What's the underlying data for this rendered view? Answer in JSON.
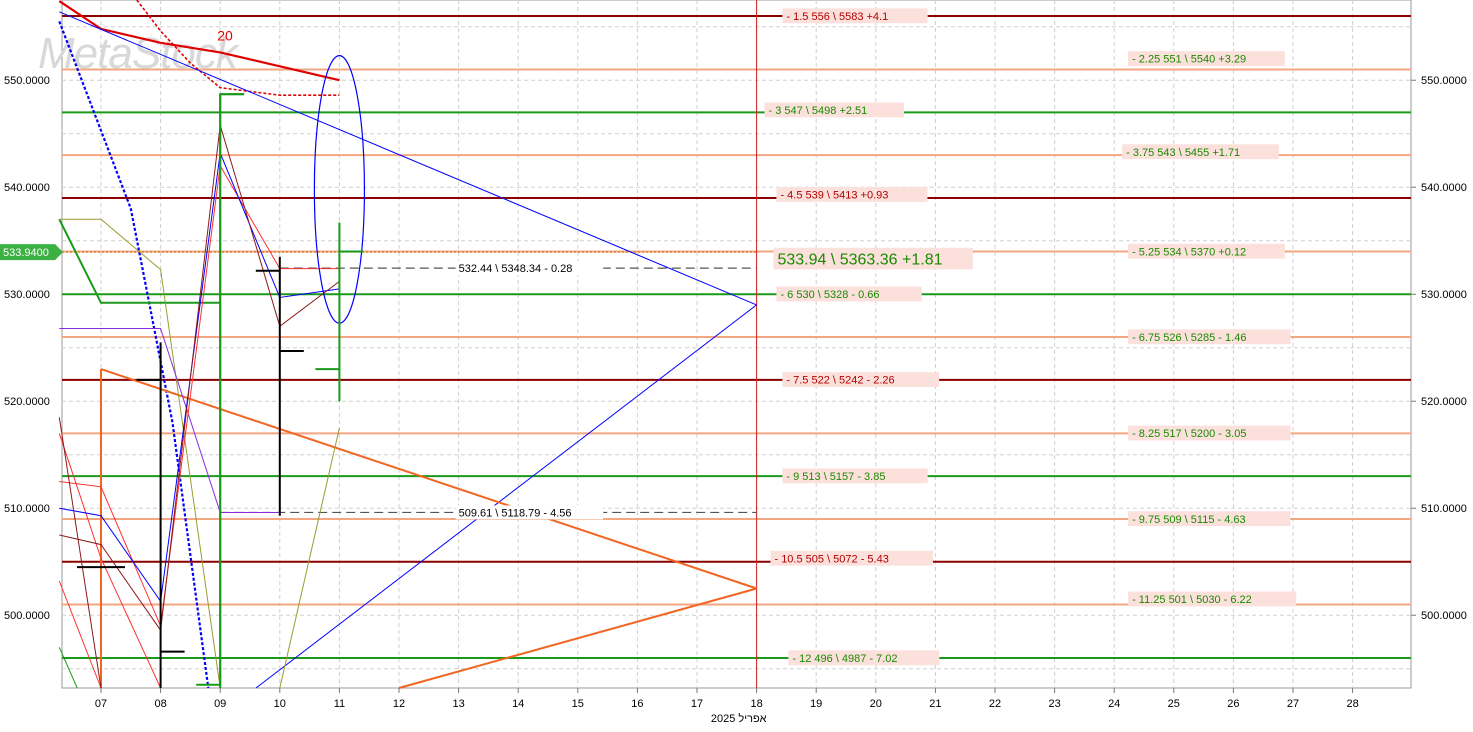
{
  "chart_data": {
    "type": "line",
    "watermark": "MetaStock",
    "month_label": "אפריל 2025",
    "x_ticks": [
      "07",
      "08",
      "09",
      "10",
      "11",
      "12",
      "13",
      "14",
      "15",
      "16",
      "17",
      "18",
      "19",
      "20",
      "21",
      "22",
      "23",
      "24",
      "25",
      "26",
      "27",
      "28"
    ],
    "ylim": [
      493.2,
      557.5
    ],
    "y_ticks": [
      500,
      510,
      520,
      530,
      540,
      550
    ],
    "y_tick_labels": [
      "500.0000",
      "510.0000",
      "520.0000",
      "530.0000",
      "540.0000",
      "550.0000"
    ],
    "y_tick_labels_left": [
      "500.0000",
      "510.0000",
      "520.0000",
      "530.0000",
      "540.0000",
      "550.0000"
    ],
    "current_price": 533.94,
    "current_price_label": "533.9400",
    "grid": true,
    "levels": [
      {
        "y": 556.0,
        "color": "#8b0000",
        "label": "- 1.5  556 \\ 5583   +4.1",
        "label_color": "#b30000",
        "label_day": 18.5,
        "label_y": 556.0
      },
      {
        "y": 551.0,
        "color": "#f4a582",
        "label": "- 2.25  551 \\ 5540   +3.29",
        "label_color": "#1a8a00",
        "label_day": 24.3,
        "label_y": 552.0
      },
      {
        "y": 547.0,
        "color": "#1a9a1a",
        "label": "- 3  547 \\ 5498   +2.51",
        "label_color": "#1a8a00",
        "label_day": 18.2,
        "label_y": 547.2
      },
      {
        "y": 543.0,
        "color": "#f4a582",
        "label": "- 3.75  543 \\ 5455   +1.71",
        "label_color": "#1a8a00",
        "label_day": 24.2,
        "label_y": 543.3
      },
      {
        "y": 539.0,
        "color": "#8b0000",
        "label": "- 4.5  539 \\ 5413   +0.93",
        "label_color": "#b30000",
        "label_day": 18.4,
        "label_y": 539.3
      },
      {
        "y": 534.0,
        "color": "#f4a582",
        "label": "- 5.25  534 \\ 5370   +0.12",
        "label_color": "#1a8a00",
        "label_day": 24.3,
        "label_y": 534.0
      },
      {
        "y": 530.0,
        "color": "#1a9a1a",
        "label": "- 6  530 \\ 5328   - 0.66",
        "label_color": "#1a8a00",
        "label_day": 18.4,
        "label_y": 530.0
      },
      {
        "y": 526.0,
        "color": "#f4a582",
        "label": "- 6.75  526 \\ 5285   - 1.46",
        "label_color": "#1a8a00",
        "label_day": 24.3,
        "label_y": 526.0
      },
      {
        "y": 522.0,
        "color": "#8b0000",
        "label": "- 7.5  522 \\ 5242   - 2.26",
        "label_color": "#b30000",
        "label_day": 18.5,
        "label_y": 522.0
      },
      {
        "y": 517.0,
        "color": "#f4a582",
        "label": "- 8.25  517 \\ 5200   - 3.05",
        "label_color": "#1a8a00",
        "label_day": 24.3,
        "label_y": 517.0
      },
      {
        "y": 513.0,
        "color": "#1a9a1a",
        "label": "- 9  513 \\ 5157   - 3.85",
        "label_color": "#1a8a00",
        "label_day": 18.5,
        "label_y": 513.0
      },
      {
        "y": 509.0,
        "color": "#f4a582",
        "label": "- 9.75  509 \\ 5115   - 4.63",
        "label_color": "#1a8a00",
        "label_day": 24.3,
        "label_y": 509.0
      },
      {
        "y": 505.0,
        "color": "#8b0000",
        "label": "- 10.5  505 \\ 5072   - 5.43",
        "label_color": "#b30000",
        "label_day": 18.3,
        "label_y": 505.3
      },
      {
        "y": 501.0,
        "color": "#f4a582",
        "label": "- 11.25  501 \\ 5030   - 6.22",
        "label_color": "#1a8a00",
        "label_day": 24.3,
        "label_y": 501.5
      },
      {
        "y": 496.0,
        "color": "#1a9a1a",
        "label": "- 12  496 \\ 4987   - 7.02",
        "label_color": "#1a8a00",
        "label_day": 18.6,
        "label_y": 496.0
      }
    ],
    "current_label": {
      "text": "533.94 \\ 5363.36  +1.81",
      "day": 18.35,
      "y": 533.3,
      "color": "#1a8a00"
    },
    "dashed_markers": [
      {
        "y": 532.44,
        "from_day": 10.0,
        "to_day": 18.0,
        "label": "532.44 \\ 5348.34  - 0.28",
        "label_day": 13.0
      },
      {
        "y": 509.61,
        "from_day": 9.0,
        "to_day": 18.0,
        "label": "509.61 \\ 5118.79  - 4.56",
        "label_day": 13.0
      }
    ],
    "ohlc_bars": [
      {
        "day": 7,
        "open": 504.5,
        "high": 504.5,
        "low": 504.5,
        "close": 504.5
      },
      {
        "day": 8,
        "open": 522.0,
        "high": 525.5,
        "low": 493.2,
        "close": 496.6
      },
      {
        "day": 9,
        "open": 493.5,
        "high": 548.7,
        "low": 493.2,
        "close": 548.7
      },
      {
        "day": 10,
        "open": 532.2,
        "high": 533.5,
        "low": 509.3,
        "close": 524.7
      },
      {
        "day": 11,
        "open": 523.0,
        "high": 536.7,
        "low": 520.0,
        "close": 534.0
      }
    ],
    "vertical_marker_day": 18,
    "annotation_20": "20",
    "series": [
      {
        "color": "#0000ff",
        "dash": "3,2",
        "width": 2.2,
        "points": [
          [
            6.3,
            555.5
          ],
          [
            7.5,
            538.0
          ],
          [
            8.2,
            518.0
          ],
          [
            8.8,
            493.2
          ]
        ]
      },
      {
        "color": "#e00000",
        "dash": "",
        "width": 2.2,
        "points": [
          [
            6.3,
            557.4
          ],
          [
            7.0,
            554.8
          ],
          [
            8.0,
            553.5
          ],
          [
            9.0,
            552.6
          ],
          [
            10.0,
            551.3
          ],
          [
            11.0,
            550.0
          ]
        ]
      },
      {
        "color": "#e00000",
        "dash": "3,2",
        "width": 1.6,
        "points": [
          [
            7.6,
            557.5
          ],
          [
            8.0,
            554.6
          ],
          [
            8.5,
            551.6
          ],
          [
            9.0,
            549.3
          ],
          [
            10.0,
            548.6
          ],
          [
            11.0,
            548.6
          ]
        ]
      },
      {
        "color": "#0000ff",
        "dash": "",
        "width": 1.0,
        "points": [
          [
            6.3,
            556.4
          ],
          [
            18.0,
            529.0
          ]
        ]
      },
      {
        "color": "#0000ff",
        "dash": "",
        "width": 1.0,
        "points": [
          [
            9.6,
            493.2
          ],
          [
            18.0,
            529.0
          ]
        ]
      },
      {
        "color": "#f26522",
        "dash": "",
        "width": 2.0,
        "points": [
          [
            7.0,
            523.0
          ],
          [
            18.0,
            502.5
          ]
        ]
      },
      {
        "color": "#f26522",
        "dash": "",
        "width": 2.0,
        "points": [
          [
            12.0,
            493.2
          ],
          [
            18.0,
            502.5
          ]
        ]
      },
      {
        "color": "#f26522",
        "dash": "",
        "width": 2.0,
        "points": [
          [
            7.0,
            493.2
          ],
          [
            7.0,
            523.0
          ]
        ]
      },
      {
        "color": "#1a9a1a",
        "dash": "",
        "width": 2.0,
        "points": [
          [
            6.3,
            537.0
          ],
          [
            7.0,
            529.2
          ],
          [
            9.0,
            529.2
          ]
        ]
      },
      {
        "color": "#1a9a1a",
        "dash": "",
        "width": 2.0,
        "points": [
          [
            9.0,
            493.2
          ],
          [
            9.0,
            548.7
          ],
          [
            9.4,
            548.7
          ]
        ]
      },
      {
        "color": "#9b9b30",
        "dash": "",
        "width": 1.0,
        "points": [
          [
            6.3,
            537.0
          ],
          [
            7.0,
            537.0
          ],
          [
            8.0,
            532.3
          ],
          [
            9.0,
            493.2
          ]
        ]
      },
      {
        "color": "#9b9b30",
        "dash": "",
        "width": 1.0,
        "points": [
          [
            10.0,
            493.2
          ],
          [
            11.0,
            517.5
          ]
        ]
      },
      {
        "color": "#8a2be2",
        "dash": "",
        "width": 1.0,
        "points": [
          [
            6.3,
            526.8
          ],
          [
            8.0,
            526.8
          ],
          [
            9.0,
            509.6
          ],
          [
            10.0,
            509.6
          ]
        ]
      },
      {
        "color": "#ff3030",
        "dash": "",
        "width": 1.0,
        "points": [
          [
            6.3,
            512.5
          ],
          [
            7.0,
            512.0
          ],
          [
            8.0,
            499.0
          ],
          [
            9.0,
            542.0
          ],
          [
            10.0,
            532.4
          ],
          [
            11.0,
            532.4
          ]
        ]
      },
      {
        "color": "#ff3030",
        "dash": "",
        "width": 1.0,
        "points": [
          [
            6.3,
            517.0
          ],
          [
            7.0,
            505.3
          ],
          [
            8.0,
            493.2
          ]
        ]
      },
      {
        "color": "#ff3030",
        "dash": "",
        "width": 1.0,
        "points": [
          [
            6.3,
            503.2
          ],
          [
            7.0,
            493.2
          ]
        ]
      },
      {
        "color": "#0000ff",
        "dash": "",
        "width": 1.0,
        "points": [
          [
            6.3,
            510.0
          ],
          [
            7.0,
            509.3
          ],
          [
            8.0,
            501.3
          ],
          [
            9.0,
            543.2
          ],
          [
            10.0,
            529.7
          ],
          [
            11.0,
            530.5
          ]
        ]
      },
      {
        "color": "#8b1a1a",
        "dash": "",
        "width": 1.0,
        "points": [
          [
            6.3,
            507.5
          ],
          [
            7.0,
            506.6
          ],
          [
            8.0,
            498.6
          ],
          [
            9.0,
            545.8
          ],
          [
            10.0,
            527.0
          ],
          [
            11.0,
            531.2
          ]
        ]
      },
      {
        "color": "#8b1a1a",
        "dash": "",
        "width": 1.0,
        "points": [
          [
            6.3,
            518.5
          ],
          [
            7.0,
            493.2
          ]
        ]
      },
      {
        "color": "#1a9a1a",
        "dash": "",
        "width": 1.0,
        "points": [
          [
            6.3,
            497.0
          ],
          [
            6.6,
            493.2
          ]
        ]
      }
    ],
    "ellipse": {
      "cx_day": 11.0,
      "cy": 539.8,
      "rx_days": 0.42,
      "ry": 12.5,
      "color": "#0000ff"
    }
  }
}
